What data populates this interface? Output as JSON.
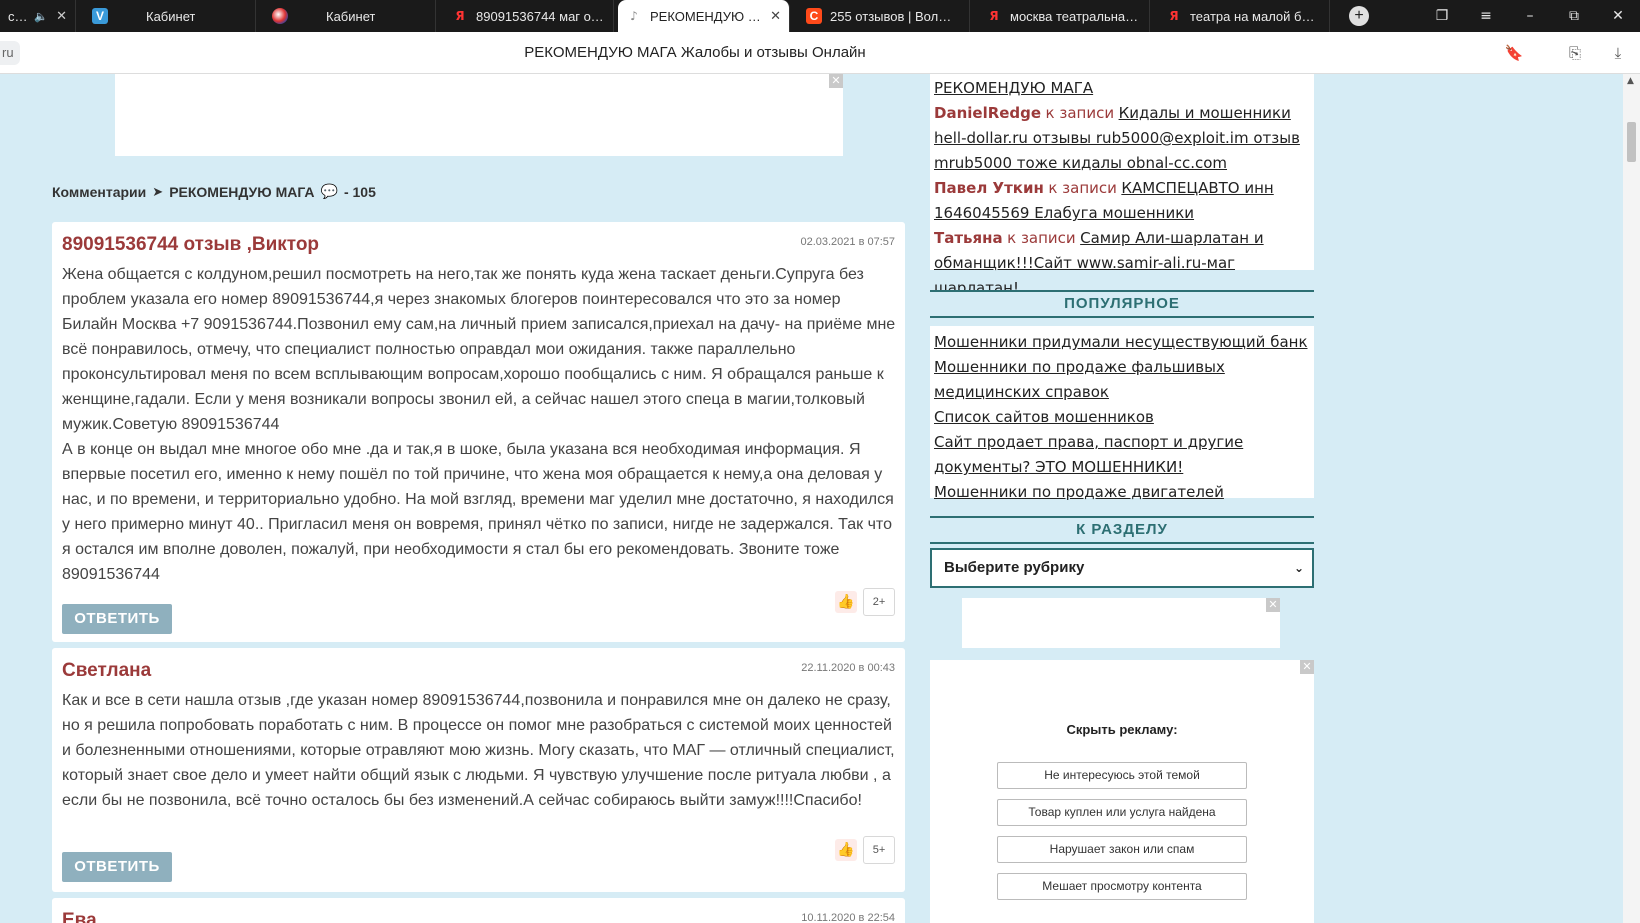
{
  "browser": {
    "tabs": [
      {
        "title": "се пе",
        "favicon": "speaker-icon"
      },
      {
        "title": "Кабинет",
        "favicon": "v-logo-icon"
      },
      {
        "title": "Кабинет",
        "favicon": "globe-icon"
      },
      {
        "title": "89091536744 маг отзы",
        "favicon": "yandex-icon"
      },
      {
        "title": "РЕКОМЕНДУЮ МАГ",
        "favicon": "audio-icon",
        "active": true
      },
      {
        "title": "255 отзывов | Волшебн",
        "favicon": "c-logo-icon"
      },
      {
        "title": "москва театральная н",
        "favicon": "yandex-icon"
      },
      {
        "title": "театра на малой брон",
        "favicon": "yandex-icon"
      }
    ],
    "url_fragment": "ru",
    "page_title": "РЕКОМЕНДУЮ МАГА Жалобы и отзывы Онлайн"
  },
  "breadcrumb": {
    "label": "Комментарии",
    "page": "РЕКОМЕНДУЮ МАГА",
    "count": "- 105"
  },
  "comments": [
    {
      "author": "89091536744 отзыв ,Виктор",
      "date": "02.03.2021 в 07:57",
      "text": "Жена общается с колдуном,решил посмотреть на него,так же понять куда жена таскает деньги.Супруга без проблем указала его номер 89091536744,я через знакомых блогеров поинтересовался что это за номер Билайн Москва +7 9091536744.Позвонил ему сам,на личный прием записался,приехал на дачу- на приёме мне всё понравилось, отмечу, что специалист полностью оправдал мои ожидания. также параллельно проконсультировал меня по всем всплывающим вопросам,хорошо пообщались с ним. Я обращался раньше к женщине,гадали. Если у меня возникали вопросы звонил ей, а сейчас нашел этого спеца в магии,толковый мужик.Советую 89091536744\nА в конце он выдал мне многое обо мне .да и так,я в шоке, была указана вся необходимая информация. Я впервые посетил его, именно к нему пошёл по той причине, что жена моя обращается к нему,а она деловая у нас, и по времени, и территориально удобно. На мой взгляд, времени маг уделил мне достаточно, я находился у него примерно минут 40.. Пригласил меня он вовремя, принял чётко по записи, нигде не задержался. Так что я остался им вполне доволен, пожалуй, при необходимости я стал бы его рекомендовать. Звоните тоже 89091536744",
      "reply_label": "ОТВЕТИТЬ",
      "votes": "2+"
    },
    {
      "author": "Светлана",
      "date": "22.11.2020 в 00:43",
      "text": "Как и все в сети нашла отзыв ,где указан номер 89091536744,позвонила и понравился мне он далеко не сразу, но я решила попробовать поработать с ним. В процессе он помог мне разобраться с системой моих ценностей и болезненными отношениями, которые отравляют мою жизнь. Могу сказать, что МАГ — отличный специалист, который знает свое дело и умеет найти общий язык с людьми. Я чувствую улучшение после ритуала любви , а если бы не позвонила, всё точно осталось бы без изменений.А сейчас собираюсь выйти замуж!!!!Спасибо!",
      "reply_label": "ОТВЕТИТЬ",
      "votes": "5+"
    },
    {
      "author": "Ева",
      "date": "10.11.2020 в 22:54"
    }
  ],
  "sidebar": {
    "recent_top_link": "РЕКОМЕНДУЮ МАГА",
    "recent": [
      {
        "author": "DanielRedge",
        "k": "к записи",
        "link": "Кидалы и мошенники hell-dollar.ru отзывы rub5000@exploit.im отзыв mrub5000 тоже кидалы obnal-cc.com"
      },
      {
        "author": "Павел Уткин",
        "k": "к записи",
        "link": "КАМСПЕЦАВТО инн 1646045569 Елабуга мошенники"
      },
      {
        "author": "Татьяна",
        "k": "к записи",
        "link": "Самир Али-шарлатан и обманщик!!!Сайт www.samir-ali.ru-маг шарлатан!"
      }
    ],
    "popular_heading": "ПОПУЛЯРНОЕ",
    "popular": [
      "Мошенники придумали несуществующий банк",
      "Мошенники по продаже фальшивых медицинских справок",
      "Список сайтов мошенников",
      "Сайт продает права, паспорт и другие документы? ЭТО МОШЕННИКИ!",
      "Мошенники по продаже двигателей"
    ],
    "section_heading": "К РАЗДЕЛУ",
    "section_select": "Выберите рубрику",
    "hide_ad": {
      "title": "Скрыть рекламу:",
      "options": [
        "Не интересуюсь этой темой",
        "Товар куплен или услуга найдена",
        "Нарушает закон или спам",
        "Мешает просмотру контента"
      ]
    }
  },
  "colors": {
    "page_bg": "#d6ecf5",
    "author": "#9b3a3a",
    "accent": "#2d6f73",
    "reply_button": "#8fb0be"
  }
}
